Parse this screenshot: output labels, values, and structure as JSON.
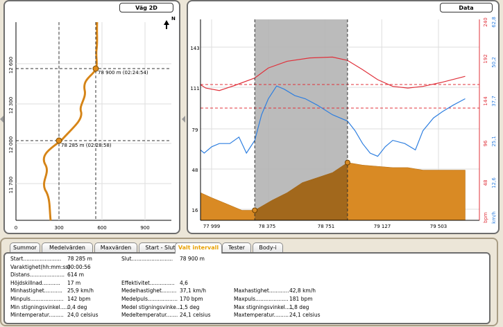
{
  "map2d": {
    "title": "Väg 2D",
    "north": "N",
    "y_ticks": [
      "12 600",
      "12 300",
      "12 000",
      "11 700"
    ],
    "x_ticks": [
      "0",
      "300",
      "600",
      "900"
    ],
    "markers": [
      {
        "label": "78 900 m (02:24:54)"
      },
      {
        "label": "78 285 m (02:28:58)"
      }
    ]
  },
  "data_panel": {
    "title": "Data",
    "left_ticks": [
      "143",
      "111",
      "79",
      "48",
      "16"
    ],
    "x_ticks": [
      "77 999",
      "78 375",
      "78 751",
      "79 127",
      "79 503"
    ],
    "bpm_ticks": [
      "240",
      "192",
      "144",
      "96",
      "48"
    ],
    "bpm_unit": "bpm",
    "kmh_ticks": [
      "62,8",
      "50,2",
      "37,7",
      "25,1",
      "12,6"
    ],
    "kmh_unit": "km/h"
  },
  "colors": {
    "heart_rate": "#e0303a",
    "speed": "#2e7fe0",
    "elevation": "#d98a24",
    "selection": "#b4b4b4",
    "route": "#e08c1c",
    "active_tab": "#e8a000"
  },
  "chart_data": {
    "type": "line",
    "x_label_values": [
      77999,
      78375,
      78751,
      79127,
      79503
    ],
    "selection": [
      78285,
      78900
    ],
    "series": [
      {
        "unit": "bpm",
        "ylim": [
          0,
          240
        ],
        "x": [
          77900,
          77960,
          78050,
          78150,
          78285,
          78375,
          78500,
          78650,
          78800,
          78900,
          79000,
          79100,
          79200,
          79300,
          79400,
          79530,
          79680
        ],
        "values": [
          162,
          158,
          155,
          161,
          170,
          182,
          190,
          194,
          195,
          191,
          180,
          168,
          160,
          158,
          160,
          165,
          172
        ]
      },
      {
        "unit": "km/h",
        "ylim": [
          0,
          62.8
        ],
        "x": [
          77900,
          77950,
          78000,
          78050,
          78120,
          78180,
          78230,
          78285,
          78330,
          78375,
          78430,
          78480,
          78550,
          78620,
          78700,
          78800,
          78900,
          78950,
          79000,
          79050,
          79100,
          79150,
          79200,
          79280,
          79350,
          79400,
          79470,
          79530,
          79600,
          79680
        ],
        "values": [
          22,
          21,
          23,
          24,
          24,
          26,
          21,
          25,
          33,
          38,
          42,
          41,
          39,
          38,
          36,
          33,
          31,
          28,
          24,
          21,
          20,
          23,
          25,
          24,
          22,
          28,
          32,
          34,
          36,
          38
        ]
      },
      {
        "unit": "elevation",
        "ylim": [
          0,
          160
        ],
        "x": [
          77900,
          78000,
          78100,
          78200,
          78285,
          78400,
          78500,
          78600,
          78700,
          78800,
          78900,
          79000,
          79100,
          79200,
          79300,
          79400,
          79500,
          79600,
          79680
        ],
        "values": [
          22,
          18,
          13,
          8,
          8,
          16,
          22,
          30,
          34,
          38,
          46,
          44,
          43,
          42,
          42,
          40,
          40,
          40,
          40
        ]
      }
    ],
    "x_ticks": [
      "77 999",
      "78 375",
      "78 751",
      "79 127",
      "79 503"
    ]
  },
  "tabs": [
    {
      "label": "Summor"
    },
    {
      "label": "Medelvärden"
    },
    {
      "label": "Maxvärden"
    },
    {
      "label": "Start - Slut"
    },
    {
      "label": "Valt intervall"
    },
    {
      "label": "Tester"
    },
    {
      "label": "Body-i"
    }
  ],
  "stats": {
    "col1": [
      {
        "label": "Start.......................",
        "value": "78 285 m"
      },
      {
        "label": "Varaktighet(hh:mm:ss)",
        "value": "00:00:56"
      },
      {
        "label": "Distans.....................",
        "value": "614 m"
      },
      {
        "label": "Höjdskillnad...........",
        "value": "17 m"
      },
      {
        "label": "Minhastighet...........",
        "value": "25,9 km/h"
      },
      {
        "label": "Minpuls....................",
        "value": "142 bpm"
      },
      {
        "label": "Min stigningsvinkel.....",
        "value": "0,4 deg"
      },
      {
        "label": "Mintemperatur.........",
        "value": "24,0 celsius"
      }
    ],
    "col2": [
      {
        "label": "Slut.........................",
        "value": "78 900 m"
      },
      {
        "label": "",
        "value": ""
      },
      {
        "label": "",
        "value": ""
      },
      {
        "label": "Effektivitet...............",
        "value": "4,6"
      },
      {
        "label": "Medelhastighet.........",
        "value": "37,1 km/h"
      },
      {
        "label": "Medelpuls..................",
        "value": "170 bpm"
      },
      {
        "label": "Medel stigningsvinke....",
        "value": "1,5 deg"
      },
      {
        "label": "Medeltemperatur.......",
        "value": "24,1 celsius"
      }
    ],
    "col3": [
      {
        "label": "",
        "value": ""
      },
      {
        "label": "",
        "value": ""
      },
      {
        "label": "",
        "value": ""
      },
      {
        "label": "",
        "value": ""
      },
      {
        "label": "Maxhastighet............",
        "value": "42,8 km/h"
      },
      {
        "label": "Maxpuls....................",
        "value": "181 bpm"
      },
      {
        "label": "Max stigningsvinkel.....",
        "value": "1,8 deg"
      },
      {
        "label": "Maxtemperatur.........",
        "value": "24,1 celsius"
      }
    ]
  }
}
